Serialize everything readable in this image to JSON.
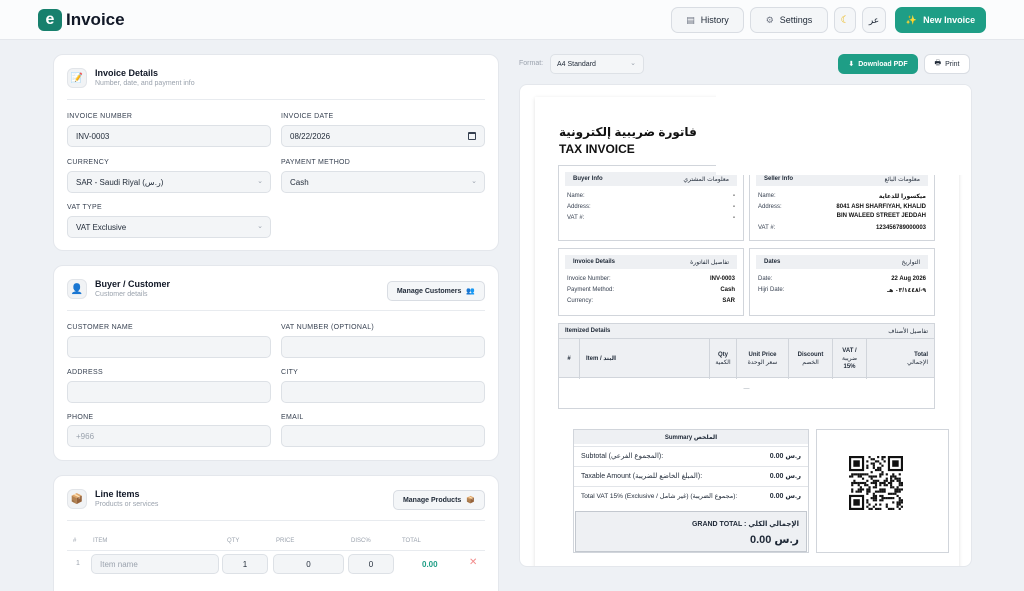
{
  "app": {
    "logo_letter": "e",
    "name": "Invoice"
  },
  "header": {
    "history": "History",
    "settings": "Settings",
    "theme_icon": "moon-icon",
    "lang": "عر",
    "new_invoice": "New Invoice"
  },
  "details": {
    "title": "Invoice Details",
    "subtitle": "Number, date, and payment info",
    "invoice_number_label": "INVOICE NUMBER",
    "invoice_number": "INV-0003",
    "invoice_date_label": "INVOICE DATE",
    "invoice_date": "08/22/2026",
    "currency_label": "CURRENCY",
    "currency": "SAR - Saudi Riyal (ر.س)",
    "payment_label": "PAYMENT METHOD",
    "payment": "Cash",
    "vat_type_label": "VAT TYPE",
    "vat_type": "VAT Exclusive"
  },
  "buyer": {
    "title": "Buyer / Customer",
    "subtitle": "Customer details",
    "manage": "Manage Customers",
    "name_label": "CUSTOMER NAME",
    "vat_label": "VAT NUMBER (OPTIONAL)",
    "address_label": "ADDRESS",
    "city_label": "CITY",
    "phone_label": "PHONE",
    "phone_placeholder": "+966",
    "email_label": "EMAIL"
  },
  "line_items": {
    "title": "Line Items",
    "subtitle": "Products or services",
    "manage": "Manage Products",
    "columns": [
      "#",
      "ITEM",
      "QTY",
      "PRICE",
      "DISC%",
      "TOTAL"
    ],
    "row": {
      "index": "1",
      "item_placeholder": "Item name",
      "qty": "1",
      "price": "0",
      "disc": "0",
      "total": "0.00"
    }
  },
  "preview_toolbar": {
    "format_label": "Format:",
    "format": "A4 Standard",
    "download": "Download PDF",
    "print": "Print"
  },
  "doc": {
    "title_ar": "فاتورة ضريبية إلكترونية",
    "title_en": "TAX INVOICE",
    "buyer_info": {
      "en": "Buyer Info",
      "ar": "معلومات المشتري",
      "name": "Name:",
      "address": "Address:",
      "vat": "VAT #:",
      "dash": "-"
    },
    "seller_info": {
      "en": "Seller Info",
      "ar": "معلومات البائع",
      "name": "Name:",
      "name_v": "ميكسورا للدعاية",
      "address": "Address:",
      "address_v1": "8041 ASH SHARFIYAH, KHALID",
      "address_v2": "BIN WALEED STREET JEDDAH",
      "vat": "VAT #:",
      "vat_v": "123456789000003"
    },
    "inv_details": {
      "en": "Invoice Details",
      "ar": "تفاصيل الفاتورة",
      "number": "Invoice Number:",
      "number_v": "INV-0003",
      "payment": "Payment Method:",
      "payment_v": "Cash",
      "currency": "Currency:",
      "currency_v": "SAR"
    },
    "dates": {
      "en": "Dates",
      "ar": "التواريخ",
      "date": "Date:",
      "date_v": "22 Aug 2026",
      "hijri": "Hijri Date:",
      "hijri_v": "٩-/٠٣/١٤٤٨ هـ"
    },
    "itemized": {
      "en": "Itemized Details",
      "ar": "تفاصيل الأصناف"
    },
    "cols": {
      "idx": "#",
      "item": "Item / البند",
      "qty": "Qty",
      "qty_ar": "الكمية",
      "unit": "Unit Price",
      "unit_ar": "سعر الوحدة",
      "disc": "Discount",
      "disc_ar": "الخصم",
      "vat": "VAT /",
      "vat_ar": "ضريبة",
      "vat_pct": "15%",
      "total": "Total",
      "total_ar": "الإجمالي"
    },
    "empty": "—",
    "summary": {
      "title": "Summary الملخص",
      "subtotal": "Subtotal (المجموع الفرعي):",
      "subtotal_v": "ر.س 0.00",
      "taxable": "Taxable Amount (المبلغ الخاضع للضريبة):",
      "taxable_v": "ر.س 0.00",
      "vat": "Total VAT 15% (Exclusive / غير شامل) (مجموع الضريبة):",
      "vat_v": "ر.س 0.00",
      "grand_label": "GRAND TOTAL : الإجمالي الكلي",
      "grand_v": "ر.س 0.00"
    }
  },
  "colors": {
    "accent": "#1e9e86",
    "brand": "#17806d"
  }
}
